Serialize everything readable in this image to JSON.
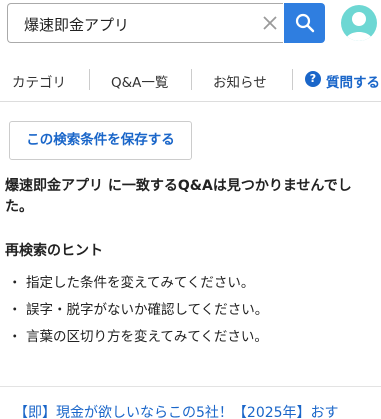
{
  "search": {
    "query": "爆速即金アプリ"
  },
  "nav": {
    "items": [
      {
        "label": "カテゴリ"
      },
      {
        "label": "Q&A一覧"
      },
      {
        "label": "お知らせ"
      },
      {
        "label": "質問する"
      }
    ]
  },
  "save_condition": {
    "label": "この検索条件を保存する"
  },
  "result": {
    "message": "爆速即金アプリ に一致するQ&Aは見つかりませんでした。"
  },
  "hints": {
    "title": "再検索のヒント",
    "bullet": "・",
    "items": [
      "指定した条件を変えてみてください。",
      "誤字・脱字がないか確認してください。",
      "言葉の区切り方を変えてみてください。"
    ]
  },
  "related": {
    "link_text": "【即】現金が欲しいならこの5社！【2025年】おす"
  },
  "colors": {
    "accent": "#2f7ee0",
    "link": "#1a66c9",
    "avatar": "#6dd7d3"
  }
}
